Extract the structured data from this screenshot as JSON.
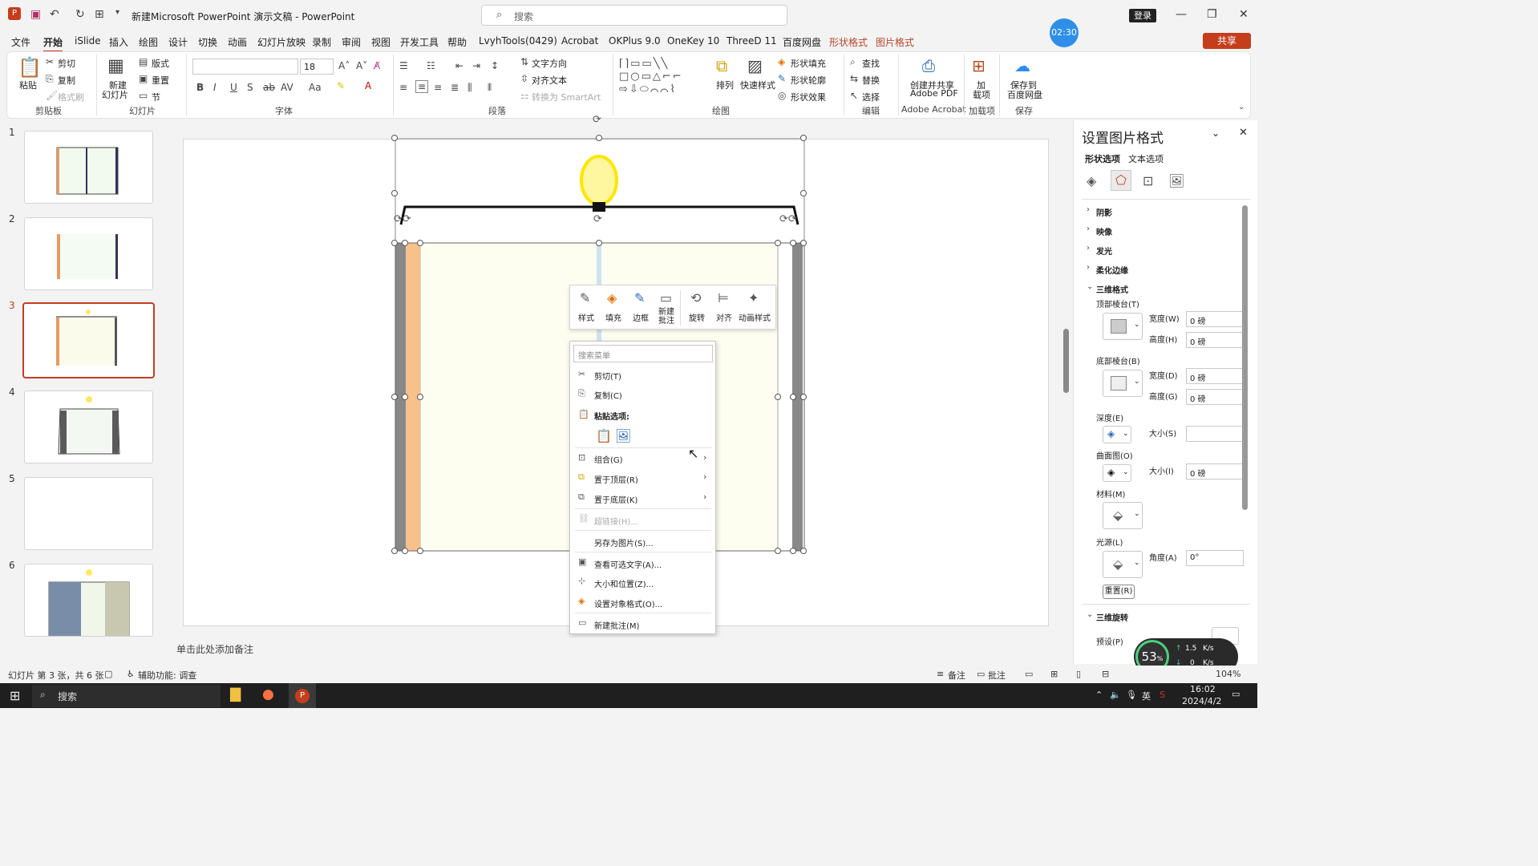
{
  "window": {
    "title": "新建Microsoft PowerPoint 演示文稿  -  PowerPoint",
    "search_placeholder": "搜索",
    "login": "登录"
  },
  "menu": {
    "tabs": [
      "文件",
      "开始",
      "iSlide",
      "插入",
      "绘图",
      "设计",
      "切换",
      "动画",
      "幻灯片放映",
      "录制",
      "审阅",
      "视图",
      "开发工具",
      "帮助",
      "LvyhTools(0429)",
      "Acrobat",
      "OKPlus 9.0",
      "OneKey 10",
      "ThreeD 11",
      "百度网盘",
      "形状格式",
      "图片格式"
    ],
    "timer": "02:30",
    "share": "共享"
  },
  "ribbon": {
    "clipboard": {
      "paste": "粘贴",
      "cut": "剪切",
      "copy": "复制",
      "painter": "格式刷",
      "group": "剪贴板"
    },
    "slides": {
      "new_slide_1": "新建",
      "new_slide_2": "幻灯片",
      "layout": "版式",
      "reset": "重置",
      "section": "节",
      "group": "幻灯片"
    },
    "font": {
      "size": "18",
      "group": "字体"
    },
    "paragraph": {
      "text_dir": "文字方向",
      "align_text": "对齐文本",
      "smartart": "转换为 SmartArt",
      "group": "段落"
    },
    "drawing": {
      "arrange": "排列",
      "quick_styles": "快速样式",
      "shape_fill": "形状填充",
      "shape_outline": "形状轮廓",
      "shape_effects": "形状效果",
      "group": "绘图"
    },
    "editing": {
      "find": "查找",
      "replace": "替换",
      "select": "选择",
      "group": "编辑"
    },
    "acrobat": {
      "create_1": "创建并共享",
      "create_2": "Adobe PDF",
      "group": "Adobe Acrobat"
    },
    "addins": {
      "label_1": "加",
      "label_2": "载项",
      "group": "加载项"
    },
    "save": {
      "label_1": "保存到",
      "label_2": "百度网盘",
      "group": "保存"
    }
  },
  "thumbnails": [
    "1",
    "2",
    "3",
    "4",
    "5",
    "6"
  ],
  "minitoolbar": [
    "样式",
    "填充",
    "边框",
    "新建\n批注",
    "旋转",
    "对齐",
    "动画样式"
  ],
  "context_menu": {
    "search_placeholder": "搜索菜单",
    "cut": "剪切(T)",
    "copy": "复制(C)",
    "paste_options": "粘贴选项:",
    "group": "组合(G)",
    "bring_front": "置于顶层(R)",
    "send_back": "置于底层(K)",
    "hyperlink": "超链接(H)...",
    "save_as_picture": "另存为图片(S)...",
    "alt_text": "查看可选文字(A)...",
    "size_position": "大小和位置(Z)...",
    "format_object": "设置对象格式(O)...",
    "new_comment": "新建批注(M)"
  },
  "notes_placeholder": "单击此处添加备注",
  "format_pane": {
    "title": "设置图片格式",
    "tab_shape": "形状选项",
    "tab_text": "文本选项",
    "sections": [
      "阴影",
      "映像",
      "发光",
      "柔化边缘",
      "三维格式",
      "三维旋转"
    ],
    "top_bevel": "顶部棱台(T)",
    "bottom_bevel": "底部棱台(B)",
    "width_w": "宽度(W)",
    "height_h": "高度(H)",
    "width_d": "宽度(D)",
    "height_g": "高度(G)",
    "top_w": "0 磅",
    "top_h": "0 磅",
    "bot_w": "0 磅",
    "bot_h": "0 磅",
    "depth": "深度(E)",
    "depth_size": "大小(S)",
    "contour": "曲面图(O)",
    "contour_size": "大小(I)",
    "contour_val": "0 磅",
    "material": "材料(M)",
    "lighting": "光源(L)",
    "angle": "角度(A)",
    "angle_val": "0°",
    "reset": "重置(R)",
    "preset": "预设(P)"
  },
  "status": {
    "slide_info": "幻灯片 第 3 张，共 6 张",
    "accessibility": "辅助功能: 调查",
    "notes": "备注",
    "comments": "批注",
    "zoom": "104%"
  },
  "network": {
    "cpu": "53",
    "up": "1.5",
    "down": "0",
    "unit": "K/s"
  },
  "taskbar": {
    "search": "搜索",
    "time": "16:02",
    "date": "2024/4/2",
    "lang": "英"
  }
}
